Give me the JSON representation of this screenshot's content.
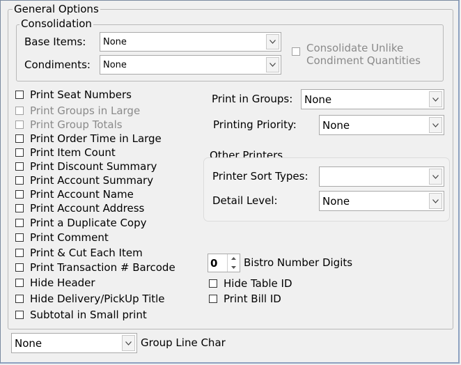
{
  "general_options": {
    "legend": "General Options",
    "consolidation": {
      "legend": "Consolidation",
      "base_items_label": "Base Items:",
      "base_items_value": "None",
      "condiments_label": "Condiments:",
      "condiments_value": "None",
      "consolidate_unlike_line1": "Consolidate Unlike",
      "consolidate_unlike_line2": "Condiment Quantities"
    },
    "left_checkboxes": [
      {
        "label": "Print Seat Numbers",
        "checked": false,
        "disabled": false
      },
      {
        "label": "Print Groups in Large",
        "checked": false,
        "disabled": true
      },
      {
        "label": "Print Group Totals",
        "checked": false,
        "disabled": true
      },
      {
        "label": "Print Order Time in Large",
        "checked": false,
        "disabled": false
      },
      {
        "label": "Print Item Count",
        "checked": false,
        "disabled": false
      },
      {
        "label": "Print Discount Summary",
        "checked": false,
        "disabled": false
      },
      {
        "label": "Print Account Summary",
        "checked": false,
        "disabled": false
      },
      {
        "label": "Print Account Name",
        "checked": false,
        "disabled": false
      },
      {
        "label": "Print Account Address",
        "checked": false,
        "disabled": false
      },
      {
        "label": "Print a Duplicate Copy",
        "checked": false,
        "disabled": false
      },
      {
        "label": "Print Comment",
        "checked": false,
        "disabled": false
      },
      {
        "label": "Print & Cut Each Item",
        "checked": false,
        "disabled": false
      },
      {
        "label": "Print Transaction # Barcode",
        "checked": false,
        "disabled": false
      },
      {
        "label": "Hide Header",
        "checked": false,
        "disabled": false
      },
      {
        "label": "Hide Delivery/PickUp Title",
        "checked": false,
        "disabled": false
      },
      {
        "label": "Subtotal in Small print",
        "checked": false,
        "disabled": false
      }
    ],
    "print_in_groups_label": "Print in Groups:",
    "print_in_groups_value": "None",
    "printing_priority_label": "Printing Priority:",
    "printing_priority_value": "None",
    "other_printers": {
      "legend": "Other Printers",
      "sort_types_label": "Printer Sort Types:",
      "sort_types_value": "",
      "detail_level_label": "Detail Level:",
      "detail_level_value": "None"
    },
    "bistro_digits_value": "0",
    "bistro_digits_label": "Bistro Number Digits",
    "hide_table_id_label": "Hide Table ID",
    "print_bill_id_label": "Print Bill ID",
    "group_line_char_value": "None",
    "group_line_char_label": "Group Line Char"
  }
}
